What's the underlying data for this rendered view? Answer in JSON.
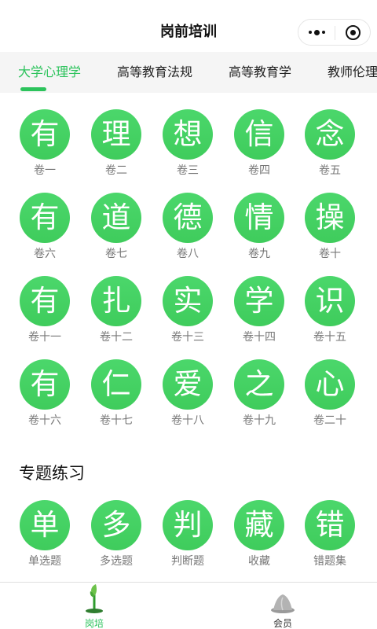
{
  "header": {
    "title": "岗前培训"
  },
  "tabs": [
    {
      "label": "大学心理学"
    },
    {
      "label": "高等教育法规"
    },
    {
      "label": "高等教育学"
    },
    {
      "label": "教师伦理"
    }
  ],
  "papers": [
    {
      "char": "有",
      "label": "卷一"
    },
    {
      "char": "理",
      "label": "卷二"
    },
    {
      "char": "想",
      "label": "卷三"
    },
    {
      "char": "信",
      "label": "卷四"
    },
    {
      "char": "念",
      "label": "卷五"
    },
    {
      "char": "有",
      "label": "卷六"
    },
    {
      "char": "道",
      "label": "卷七"
    },
    {
      "char": "德",
      "label": "卷八"
    },
    {
      "char": "情",
      "label": "卷九"
    },
    {
      "char": "操",
      "label": "卷十"
    },
    {
      "char": "有",
      "label": "卷十一"
    },
    {
      "char": "扎",
      "label": "卷十二"
    },
    {
      "char": "实",
      "label": "卷十三"
    },
    {
      "char": "学",
      "label": "卷十四"
    },
    {
      "char": "识",
      "label": "卷十五"
    },
    {
      "char": "有",
      "label": "卷十六"
    },
    {
      "char": "仁",
      "label": "卷十七"
    },
    {
      "char": "爱",
      "label": "卷十八"
    },
    {
      "char": "之",
      "label": "卷十九"
    },
    {
      "char": "心",
      "label": "卷二十"
    }
  ],
  "topics": {
    "title": "专题练习",
    "items": [
      {
        "char": "单",
        "label": "单选题"
      },
      {
        "char": "多",
        "label": "多选题"
      },
      {
        "char": "判",
        "label": "判断题"
      },
      {
        "char": "藏",
        "label": "收藏"
      },
      {
        "char": "错",
        "label": "错题集"
      }
    ]
  },
  "bottom_nav": [
    {
      "label": "岗培",
      "icon": "sprout-icon"
    },
    {
      "label": "会员",
      "icon": "member-avatar-icon"
    }
  ],
  "colors": {
    "accent": "#2cc35c",
    "circle": "#45d163",
    "label": "#777777",
    "tab_bg": "#f5f5f5"
  }
}
